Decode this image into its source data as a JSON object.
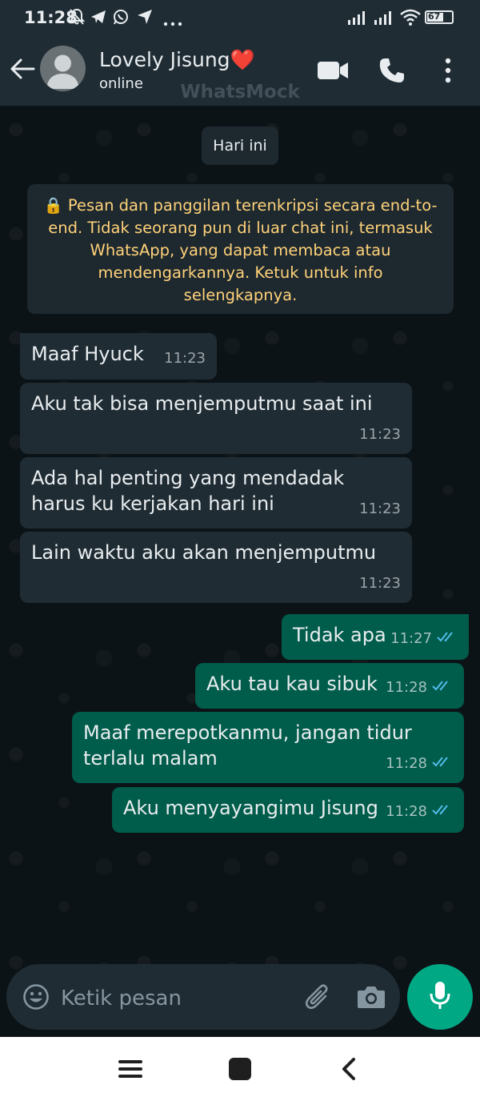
{
  "status_bar": {
    "time": "11:28",
    "battery_level": "67",
    "icons": [
      "muted-alarm-icon",
      "telegram-icon",
      "whatsapp-icon",
      "location-arrow-icon",
      "more-dots-icon",
      "signal-icon",
      "wifi-icon",
      "battery-icon"
    ]
  },
  "header": {
    "contact_name": "Lovely Jisung❤️",
    "status": "online",
    "watermark": "WhatsMock",
    "actions": [
      "video-call-icon",
      "voice-call-icon",
      "menu-icon"
    ]
  },
  "chat": {
    "date_chip": "Hari ini",
    "encryption_notice": "🔒 Pesan dan panggilan terenkripsi secara end-to-end. Tidak seorang pun di luar chat ini, termasuk WhatsApp, yang dapat membaca atau mendengarkannya. Ketuk untuk info selengkapnya.",
    "messages": [
      {
        "direction": "in",
        "text": "Maaf Hyuck",
        "time": "11:23"
      },
      {
        "direction": "in",
        "text": "Aku tak bisa menjemputmu saat ini",
        "time": "11:23"
      },
      {
        "direction": "in",
        "text": "Ada hal penting yang mendadak harus ku kerjakan hari ini",
        "time": "11:23"
      },
      {
        "direction": "in",
        "text": "Lain waktu aku akan menjemputmu",
        "time": "11:23"
      },
      {
        "direction": "out",
        "text": "Tidak apa",
        "time": "11:27",
        "status": "read"
      },
      {
        "direction": "out",
        "text": "Aku tau kau sibuk",
        "time": "11:28",
        "status": "read"
      },
      {
        "direction": "out",
        "text": "Maaf merepotkanmu, jangan tidur terlalu malam",
        "time": "11:28",
        "status": "read"
      },
      {
        "direction": "out",
        "text": "Aku menyayangimu Jisung",
        "time": "11:28",
        "status": "read"
      }
    ]
  },
  "input": {
    "placeholder": "Ketik pesan",
    "value": ""
  },
  "colors": {
    "header_bg": "#1f2c34",
    "chat_bg": "#0c1317",
    "incoming_bubble": "#1f2c34",
    "outgoing_bubble": "#005c4b",
    "notice_text": "#ffd279",
    "accent": "#00a884",
    "read_tick": "#53bdeb"
  }
}
